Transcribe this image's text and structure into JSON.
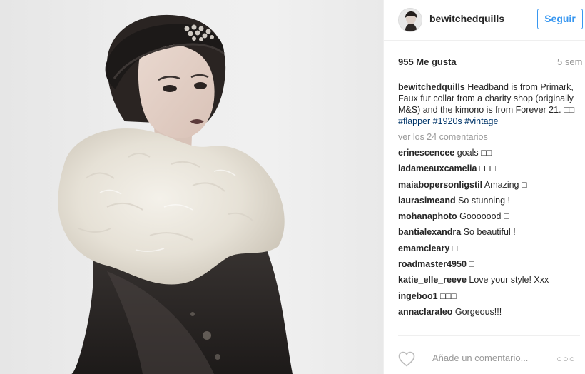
{
  "post": {
    "username": "bewitchedquills",
    "follow_label": "Seguir",
    "likes": "955 Me gusta",
    "time": "5 sem",
    "caption": {
      "author": "bewitchedquills",
      "text": " Headband is from Primark, Faux fur collar from a charity shop (originally M&S) and the kimono is from Forever 21. □□ ",
      "tag1": "#flapper",
      "tag2": "#1920s",
      "tag3": "#vintage"
    },
    "view_all_label": "ver los 24 comentarios",
    "comments": [
      {
        "author": "erinescencee",
        "text": " goals □□"
      },
      {
        "author": "ladameauxcamelia",
        "text": " □□□"
      },
      {
        "author": "maiabopersonligstil",
        "text": " Amazing □"
      },
      {
        "author": "laurasimeand",
        "text": " So stunning !"
      },
      {
        "author": "mohanaphoto",
        "text": " Gooooood □"
      },
      {
        "author": "bantialexandra",
        "text": " So beautiful !"
      },
      {
        "author": "emamcleary",
        "text": " □"
      },
      {
        "author": "roadmaster4950",
        "text": " □"
      },
      {
        "author": "katie_elle_reeve",
        "text": " Love your style! Xxx"
      },
      {
        "author": "ingeboo1",
        "text": " □□□"
      },
      {
        "author": "annaclaraleo",
        "text": " Gorgeous!!!"
      }
    ],
    "add_comment_placeholder": "Añade un comentario...",
    "more_label": "○○○"
  },
  "icons": {
    "like": "heart-outline-icon",
    "options": "more-options-icon"
  },
  "colors": {
    "link_blue": "#3897f0",
    "hashtag": "#003569",
    "muted": "#999999",
    "text": "#262626",
    "divider": "#efefef"
  }
}
